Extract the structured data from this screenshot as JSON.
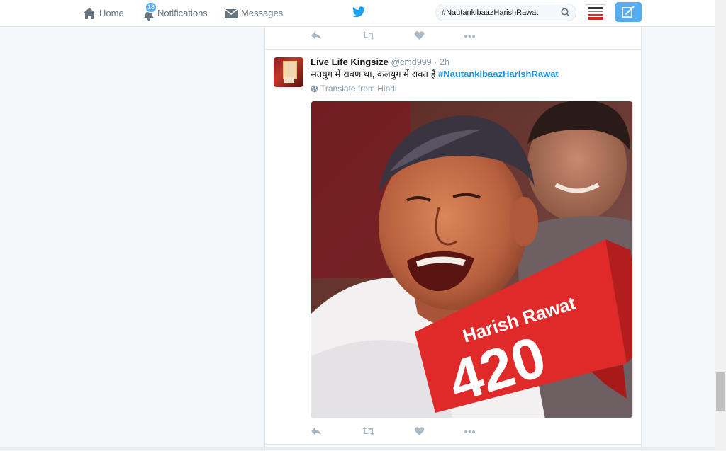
{
  "nav": {
    "home_label": "Home",
    "notifications_label": "Notifications",
    "notifications_count": "18",
    "messages_label": "Messages"
  },
  "search": {
    "value": "#NautankibaazHarishRawat"
  },
  "tweet": {
    "fullname": "Live Life Kingsize",
    "handle": "@cmd999",
    "separator": "·",
    "time": "2h",
    "text": "सतयुग में रावण था, कलयुग में रावत हैं ",
    "hashtag": "#NautankibaazHarishRawat",
    "translate_label": "Translate from Hindi",
    "image_banner_name": "Harish Rawat",
    "image_banner_number": "420"
  },
  "colors": {
    "brand": "#55acee",
    "link": "#1b95e0",
    "banner_red": "#e02a2a"
  }
}
